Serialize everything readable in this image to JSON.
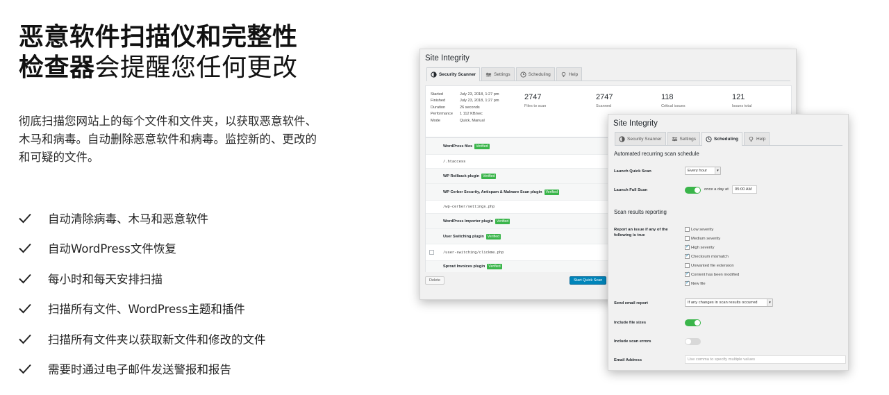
{
  "hero": {
    "title_bold_1": "恶意软件扫描仪和完整性",
    "title_bold_2": "检查器",
    "title_thin": "会提醒您任何更改",
    "description": "彻底扫描您网站上的每个文件和文件夹，以获取恶意软件、木马和病毒。自动删除恶意软件和病毒。监控新的、更改的和可疑的文件。"
  },
  "features": [
    "自动清除病毒、木马和恶意软件",
    "自动WordPress文件恢复",
    "每小时和每天安排扫描",
    "扫描所有文件、WordPress主题和插件",
    "扫描所有文件夹以获取新文件和修改的文件",
    "需要时通过电子邮件发送警报和报告"
  ],
  "back_window": {
    "title": "Site Integrity",
    "tabs": [
      "Security Scanner",
      "Settings",
      "Scheduling",
      "Help"
    ],
    "meta": [
      {
        "k": "Started",
        "v": "July 23, 2018, 1:27 pm"
      },
      {
        "k": "Finished",
        "v": "July 23, 2018, 1:27 pm"
      },
      {
        "k": "Duration",
        "v": "26 seconds"
      },
      {
        "k": "Performance",
        "v": "1 112 KB/sec"
      },
      {
        "k": "Mode",
        "v": "Quick, Manual"
      }
    ],
    "stats": [
      {
        "num": "2747",
        "label": "Files to scan"
      },
      {
        "num": "2747",
        "label": "Scanned"
      },
      {
        "num": "118",
        "label": "Critical issues"
      },
      {
        "num": "121",
        "label": "Issues total"
      }
    ],
    "rows": [
      {
        "text": "WordPress files",
        "type": "plugin",
        "badge": "Verified"
      },
      {
        "text": "/.htaccess",
        "type": "path"
      },
      {
        "text": "WP Rollback plugin",
        "type": "plugin",
        "badge": "Verified"
      },
      {
        "text": "WP Cerber Security, Antispam & Malware Scan plugin",
        "type": "plugin",
        "badge": "Verified"
      },
      {
        "text": "/wp-cerber/settings.php",
        "type": "path"
      },
      {
        "text": "WordPress Importer plugin",
        "type": "plugin",
        "badge": "Verified"
      },
      {
        "text": "User Switching plugin",
        "type": "plugin",
        "badge": "Verified"
      },
      {
        "text": "/user-switching/clickme.php",
        "type": "path",
        "checkbox": true
      },
      {
        "text": "Sprout Invoices plugin",
        "type": "plugin",
        "badge": "Verified"
      }
    ],
    "delete_label": "Delete",
    "quick_scan_label": "Start Quick Scan"
  },
  "front_window": {
    "title": "Site Integrity",
    "tabs": [
      "Security Scanner",
      "Settings",
      "Scheduling",
      "Help"
    ],
    "sched_heading": "Automated recurring scan schedule",
    "launch_quick_label": "Launch Quick Scan",
    "launch_quick_value": "Every hour",
    "launch_full_label": "Launch Full Scan",
    "launch_full_on": true,
    "launch_full_text": "once a day at",
    "launch_full_time": "05:00 AM",
    "report_heading": "Scan results reporting",
    "report_label": "Report an issue if any of the following is true",
    "report_options": [
      {
        "label": "Low severity",
        "checked": false
      },
      {
        "label": "Medium severity",
        "checked": false
      },
      {
        "label": "High severity",
        "checked": true
      },
      {
        "label": "Checksum mismatch",
        "checked": true
      },
      {
        "label": "Unwanted file extension",
        "checked": false
      },
      {
        "label": "Content has been modified",
        "checked": true
      },
      {
        "label": "New file",
        "checked": true
      }
    ],
    "email_report_label": "Send email report",
    "email_report_value": "If any changes in scan results occurred",
    "file_sizes_label": "Include file sizes",
    "file_sizes_on": true,
    "scan_errors_label": "Include scan errors",
    "scan_errors_on": false,
    "email_address_label": "Email Address",
    "email_address_placeholder": "Use comma to specify multiple values"
  },
  "colors": {
    "accent_green": "#3ab54a",
    "primary_button": "#0085ba"
  }
}
